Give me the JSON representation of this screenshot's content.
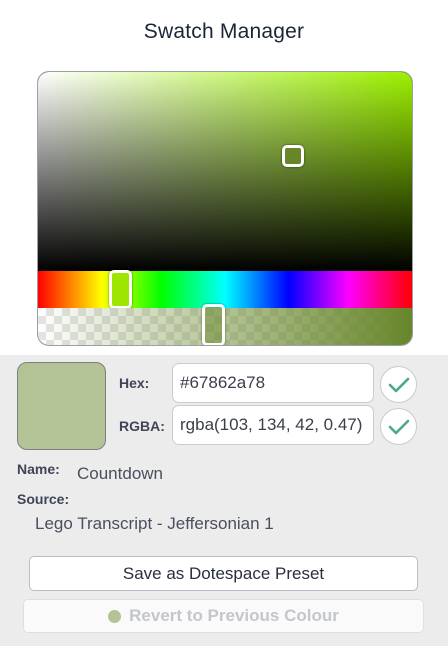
{
  "title": "Swatch Manager",
  "picker": {
    "hue_color": "#9cf000",
    "selected_color": "#67862a",
    "alpha": 0.47
  },
  "fields": {
    "hex_label": "Hex:",
    "hex_value": "#67862a78",
    "rgba_label": "RGBA:",
    "rgba_value": "rgba(103, 134, 42, 0.47)"
  },
  "meta": {
    "name_label": "Name:",
    "name_value": "Countdown",
    "source_label": "Source:",
    "source_value": "Lego Transcript - Jeffersonian 1"
  },
  "buttons": {
    "save_label": "Save as Dotespace Preset",
    "revert_label": "Revert to Previous Colour"
  },
  "colors": {
    "preview": "#b3c396",
    "check": "#4aa88a",
    "panel_bg": "#ececec"
  }
}
